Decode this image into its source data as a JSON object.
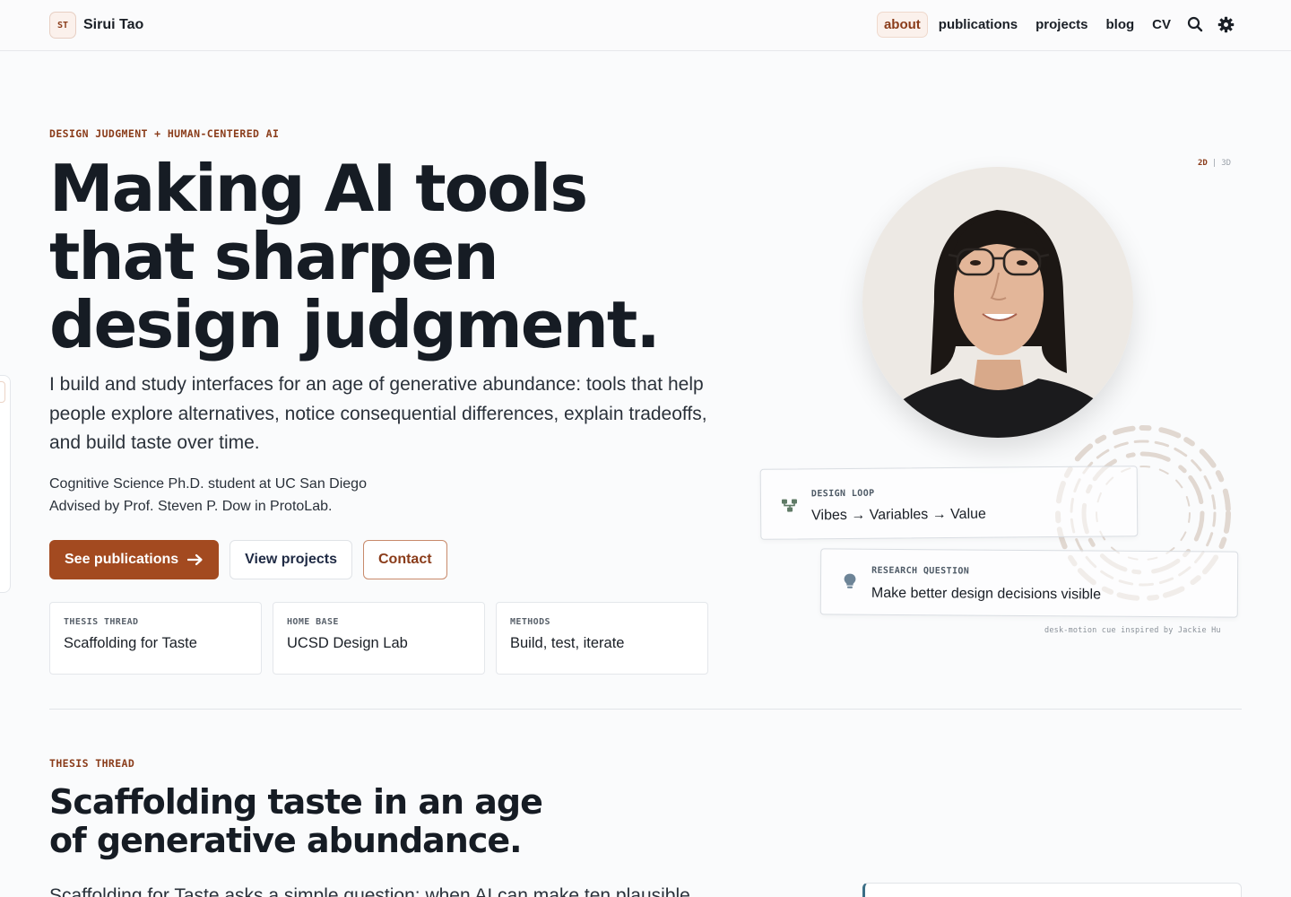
{
  "header": {
    "brand_mark": "ST",
    "brand_name": "Sirui Tao",
    "nav": [
      {
        "label": "about",
        "active": true
      },
      {
        "label": "publications",
        "active": false
      },
      {
        "label": "projects",
        "active": false
      },
      {
        "label": "blog",
        "active": false
      },
      {
        "label": "CV",
        "active": false
      }
    ],
    "icons": [
      "search-icon",
      "theme-toggle-gear-icon"
    ]
  },
  "hero": {
    "eyebrow": "DESIGN JUDGMENT + HUMAN-CENTERED AI",
    "title_lines": [
      "Making AI tools",
      "that sharpen",
      "design judgment."
    ],
    "lede": "I build and study interfaces for an age of generative abundance: tools that help people explore alternatives, notice consequential differences, explain tradeoffs, and build taste over time.",
    "meta_line_1": "Cognitive Science Ph.D. student at UC San Diego",
    "meta_line_2": "Advised by Prof. Steven P. Dow in ProtoLab.",
    "buttons": {
      "primary": "See publications",
      "secondary": "View projects",
      "contact": "Contact"
    },
    "facts": [
      {
        "label": "THESIS THREAD",
        "value": "Scaffolding for Taste"
      },
      {
        "label": "HOME BASE",
        "value": "UCSD Design Lab"
      },
      {
        "label": "METHODS",
        "value": "Build, test, iterate"
      }
    ]
  },
  "visual": {
    "toggle_2d": "2D",
    "toggle_sep": "|",
    "toggle_3d": "3D",
    "cards": [
      {
        "label": "DESIGN LOOP",
        "value": "Vibes → Variables → Value",
        "icon": "flow-icon"
      },
      {
        "label": "RESEARCH QUESTION",
        "value": "Make better design decisions visible",
        "icon": "lightbulb-icon"
      }
    ],
    "credit": "desk-motion cue inspired by Jackie Hu"
  },
  "section": {
    "eyebrow": "THESIS THREAD",
    "title_lines": [
      "Scaffolding taste in an age",
      "of generative abundance."
    ],
    "body_start": "Scaffolding for Taste asks a simple question: when AI can make ten plausible"
  },
  "colors": {
    "accent": "#a34a20",
    "accent_text": "#8a3c1a",
    "ink": "#161c24",
    "background": "#fafbfc"
  }
}
